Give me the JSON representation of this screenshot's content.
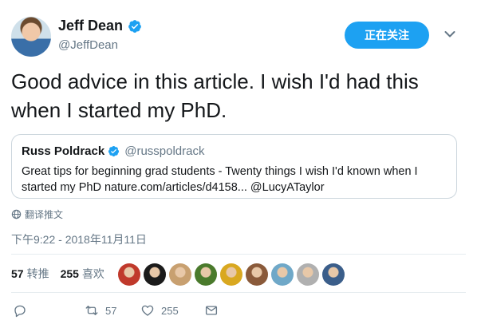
{
  "author": {
    "name": "Jeff Dean",
    "handle": "@JeffDean",
    "verified": true
  },
  "follow_button_label": "正在关注",
  "tweet_text": "Good advice in this article.  I wish I'd had this when I started my PhD.",
  "quote": {
    "name": "Russ Poldrack",
    "handle": "@russpoldrack",
    "text": "Great tips for beginning grad students - Twenty things I wish I'd known when I started my PhD nature.com/articles/d4158... @LucyATaylor"
  },
  "translate_label": "翻译推文",
  "timestamp": "下午9:22 - 2018年11月11日",
  "stats": {
    "retweets_count": "57",
    "retweets_label": "转推",
    "likes_count": "255",
    "likes_label": "喜欢"
  },
  "actions": {
    "retweet_count": "57",
    "like_count": "255"
  },
  "colors": {
    "accent": "#1da1f2",
    "secondary_text": "#657786"
  },
  "liker_avatars": [
    "#c0392b",
    "#1b1b1b",
    "#c8a070",
    "#4a7a2c",
    "#d9a820",
    "#8a5a3a",
    "#6fa8c8",
    "#b0b0b0",
    "#3b5e8a"
  ]
}
